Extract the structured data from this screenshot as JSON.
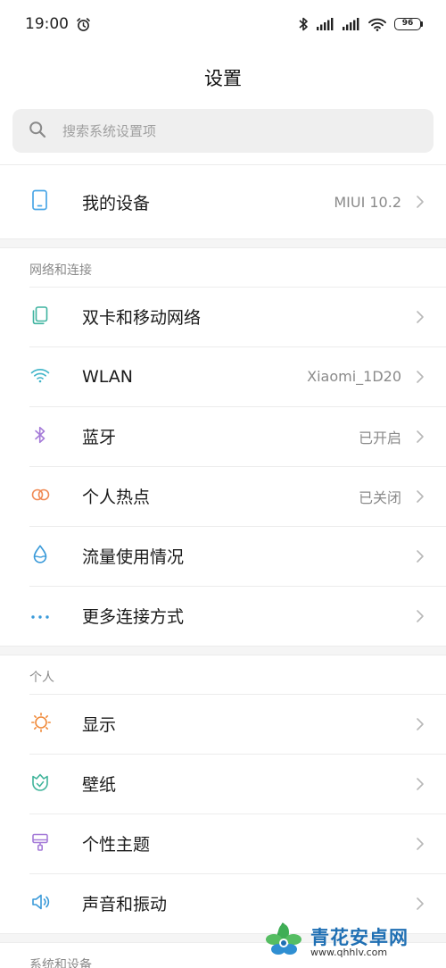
{
  "status": {
    "time": "19:00",
    "battery": "96"
  },
  "header": {
    "title": "设置"
  },
  "search": {
    "placeholder": "搜索系统设置项"
  },
  "device": {
    "label": "我的设备",
    "value": "MIUI 10.2",
    "icon": "phone-icon",
    "color": "#4aa6e6"
  },
  "sections": {
    "network": {
      "header": "网络和连接",
      "items": [
        {
          "label": "双卡和移动网络",
          "value": "",
          "icon": "sim-cards-icon",
          "color": "#3fb4a0"
        },
        {
          "label": "WLAN",
          "value": "Xiaomi_1D20",
          "icon": "wifi-icon",
          "color": "#3fb4c8"
        },
        {
          "label": "蓝牙",
          "value": "已开启",
          "icon": "bluetooth-icon",
          "color": "#a57bd8"
        },
        {
          "label": "个人热点",
          "value": "已关闭",
          "icon": "hotspot-icon",
          "color": "#f08a55"
        },
        {
          "label": "流量使用情况",
          "value": "",
          "icon": "data-usage-icon",
          "color": "#3a9ad9"
        },
        {
          "label": "更多连接方式",
          "value": "",
          "icon": "more-dots-icon",
          "color": "#3a9ad9"
        }
      ]
    },
    "personal": {
      "header": "个人",
      "items": [
        {
          "label": "显示",
          "value": "",
          "icon": "brightness-icon",
          "color": "#f08a3a"
        },
        {
          "label": "壁纸",
          "value": "",
          "icon": "wallpaper-icon",
          "color": "#3fb49a"
        },
        {
          "label": "个性主题",
          "value": "",
          "icon": "theme-brush-icon",
          "color": "#a57bd8"
        },
        {
          "label": "声音和振动",
          "value": "",
          "icon": "speaker-icon",
          "color": "#3a9ad9"
        }
      ]
    },
    "system": {
      "header": "系统和设备"
    }
  },
  "watermark": {
    "title": "青花安卓网",
    "url": "www.qhhlv.com"
  }
}
